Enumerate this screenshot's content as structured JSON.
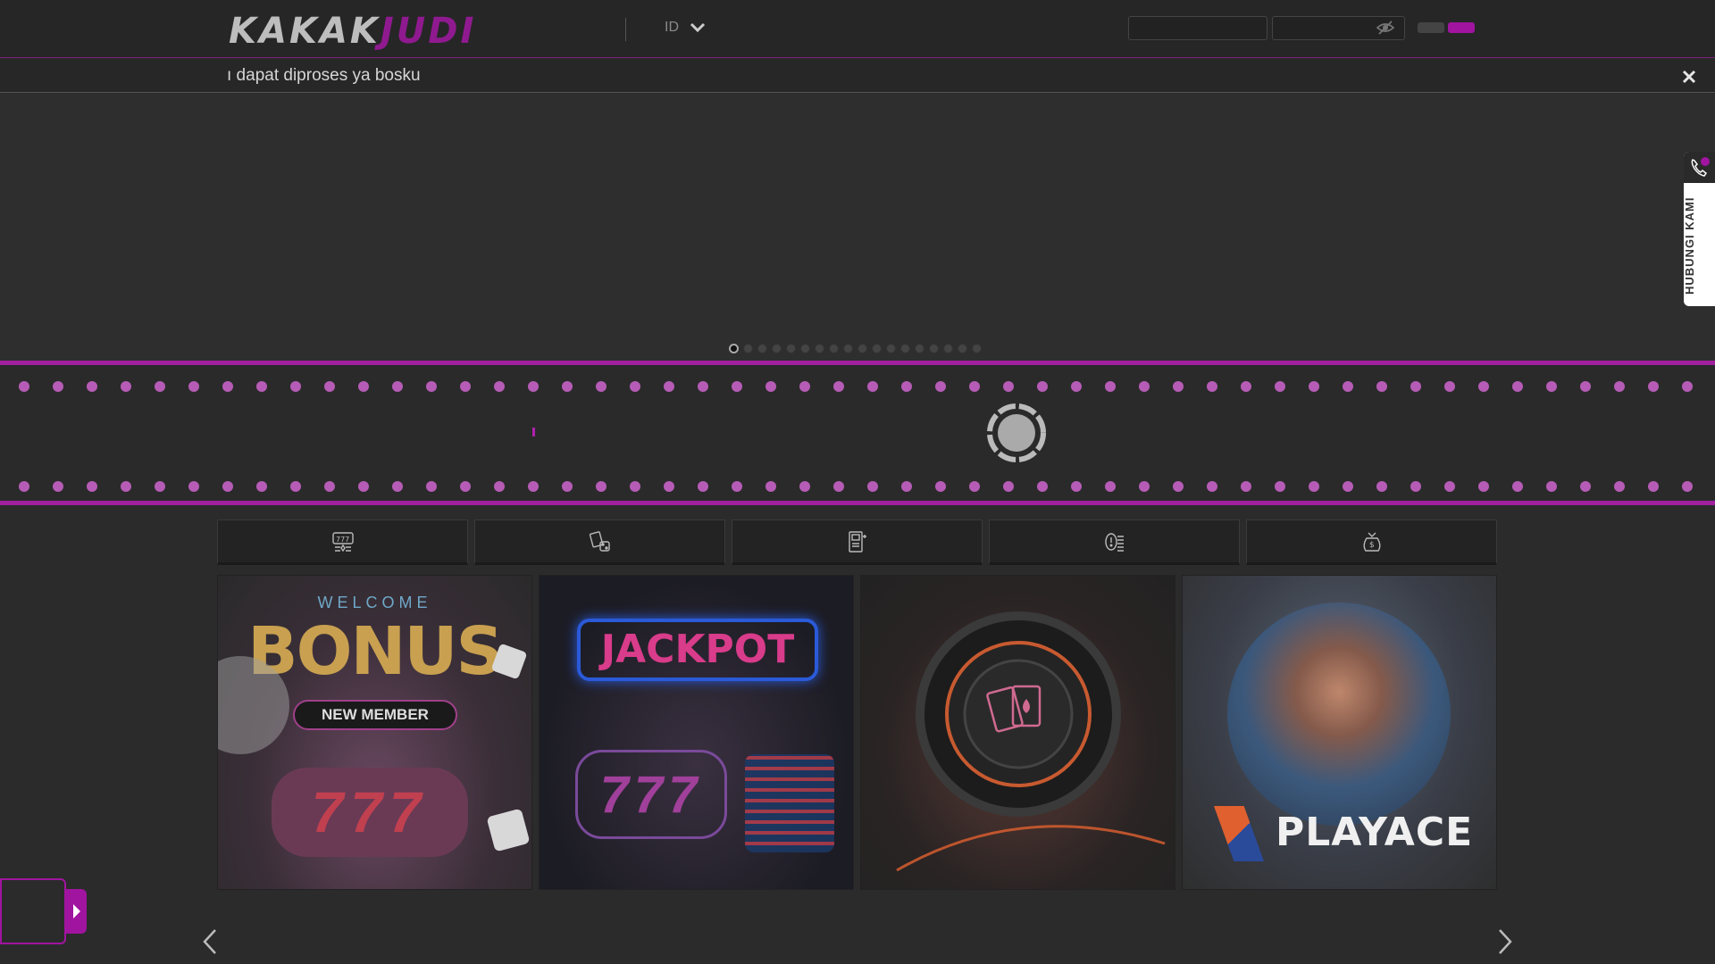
{
  "header": {
    "logo_part1": "KAKAK",
    "logo_part2": "JUDI",
    "language": "ID",
    "username_placeholder": "",
    "password_placeholder": "",
    "colors": {
      "accent": "#a014a0",
      "background": "#262626"
    }
  },
  "marquee": {
    "text": "ı dapat diproses ya bosku"
  },
  "hero": {
    "slide_count": 18,
    "active_slide": 1
  },
  "contact": {
    "label": "HUBUNGI KAMI",
    "icon": "phone-icon"
  },
  "category_tabs": [
    {
      "icon": "slot-machine-icon"
    },
    {
      "icon": "cards-dice-icon"
    },
    {
      "icon": "arcade-machine-icon"
    },
    {
      "icon": "casino-chips-icon"
    },
    {
      "icon": "money-bag-icon"
    }
  ],
  "promo_cards": [
    {
      "top_text": "WELCOME",
      "main_text": "BONUS",
      "badge": "NEW MEMBER",
      "reels": "777"
    },
    {
      "main_text": "JACKPOT",
      "reels": "777"
    },
    {
      "icon": "poker-chip-cards-icon"
    },
    {
      "brand": "PLAYACE"
    }
  ]
}
